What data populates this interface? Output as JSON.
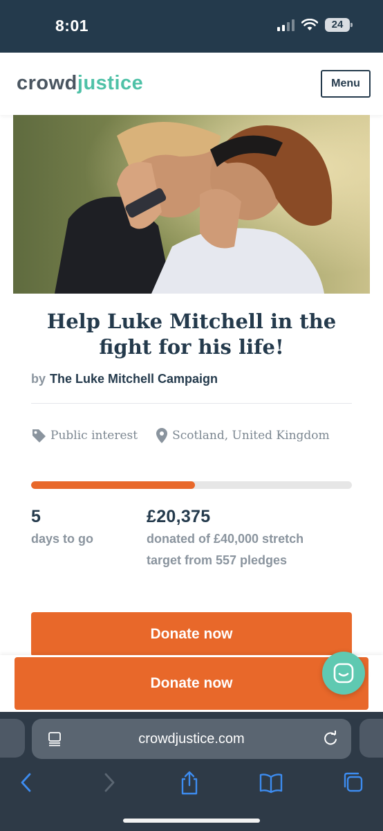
{
  "status_bar": {
    "time": "8:01",
    "battery": "24",
    "icons": [
      "cellular-signal-icon",
      "wifi-icon",
      "battery-icon"
    ]
  },
  "header": {
    "logo_part1": "crowd",
    "logo_part2": "justice",
    "menu_label": "Menu"
  },
  "campaign": {
    "title_line1": "Help Luke Mitchell in the",
    "title_line2": "fight for his life!",
    "by_label": "by",
    "author": "The Luke Mitchell Campaign",
    "category": "Public interest",
    "location": "Scotland, United Kingdom",
    "progress_fraction": 0.51,
    "days_value": "5",
    "days_label": "days to go",
    "amount_value": "£20,375",
    "amount_label": "donated of £40,000 stretch target from 557 pledges",
    "donate_label": "Donate now"
  },
  "sticky": {
    "donate_label": "Donate now"
  },
  "browser": {
    "url": "crowdjustice.com",
    "toolbar_icons": [
      "back-icon",
      "forward-icon",
      "share-icon",
      "bookmarks-icon",
      "tabs-icon"
    ]
  },
  "colors": {
    "navy": "#243a4c",
    "accent_orange": "#e8682a",
    "logo_teal": "#4fc1a7",
    "chat_teal": "#5fc9b1"
  }
}
